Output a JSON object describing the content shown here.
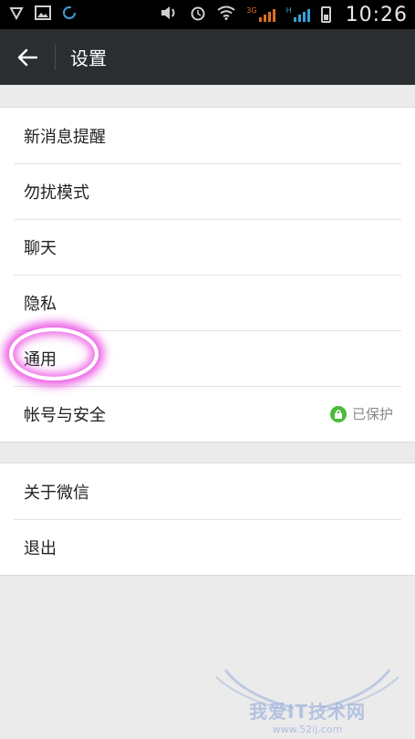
{
  "status_bar": {
    "time": "10:26",
    "network_label_1": "3G",
    "network_label_2": "H"
  },
  "action_bar": {
    "title": "设置"
  },
  "settings_group_1": [
    {
      "label": "新消息提醒"
    },
    {
      "label": "勿扰模式"
    },
    {
      "label": "聊天"
    },
    {
      "label": "隐私"
    },
    {
      "label": "通用"
    },
    {
      "label": "帐号与安全",
      "status": "已保护"
    }
  ],
  "settings_group_2": [
    {
      "label": "关于微信"
    },
    {
      "label": "退出"
    }
  ],
  "watermark": {
    "text": "我爱IT技术网",
    "url": "www.52ij.com"
  },
  "colors": {
    "action_bar": "#2b2e31",
    "background": "#ebebeb",
    "protected_green": "#4cba3a",
    "highlight_pink": "#e628dc"
  }
}
